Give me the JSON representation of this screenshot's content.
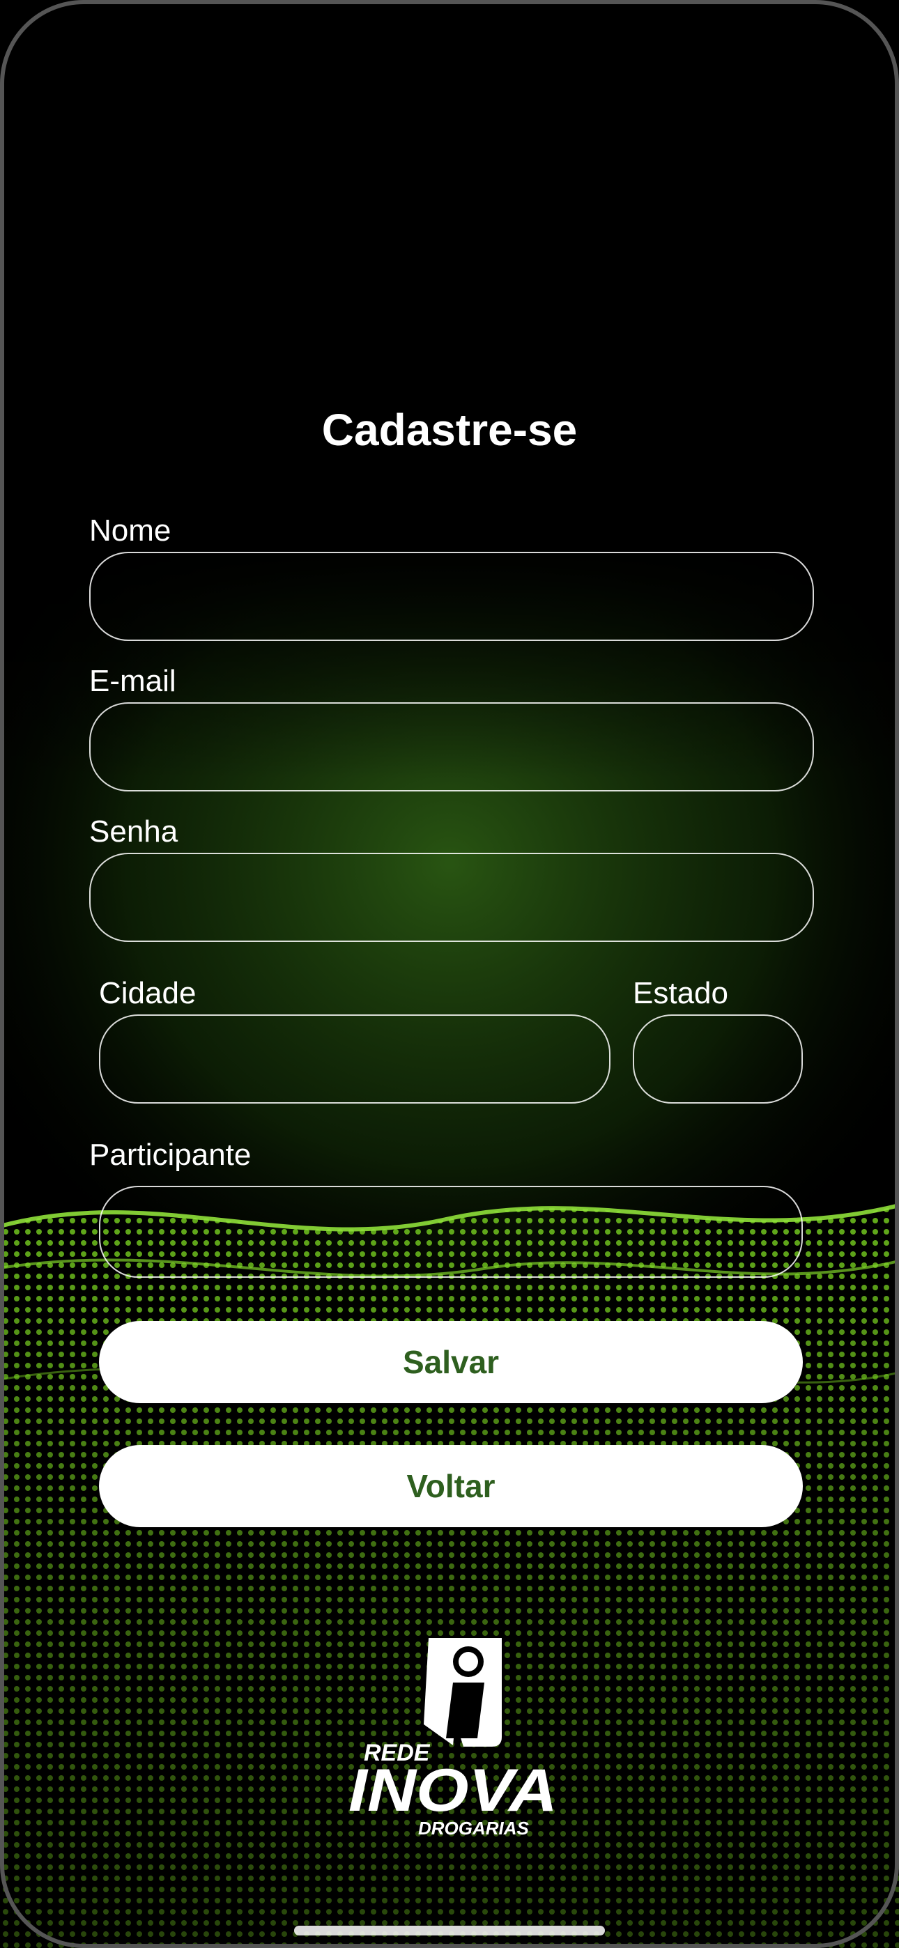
{
  "page": {
    "title": "Cadastre-se"
  },
  "form": {
    "nome_label": "Nome",
    "nome_value": "",
    "email_label": "E-mail",
    "email_value": "",
    "senha_label": "Senha",
    "senha_value": "",
    "cidade_label": "Cidade",
    "cidade_value": "",
    "estado_label": "Estado",
    "estado_value": "",
    "participante_label": "Participante",
    "participante_value": ""
  },
  "buttons": {
    "save_label": "Salvar",
    "back_label": "Voltar"
  },
  "logo": {
    "line1": "REDE",
    "line2": "INOVA",
    "line3": "DROGARIAS",
    "icon": "i-mark-icon"
  },
  "colors": {
    "background": "#000000",
    "accent_green": "#7fd22a",
    "button_text": "#2e5f1f",
    "button_bg": "#ffffff"
  }
}
